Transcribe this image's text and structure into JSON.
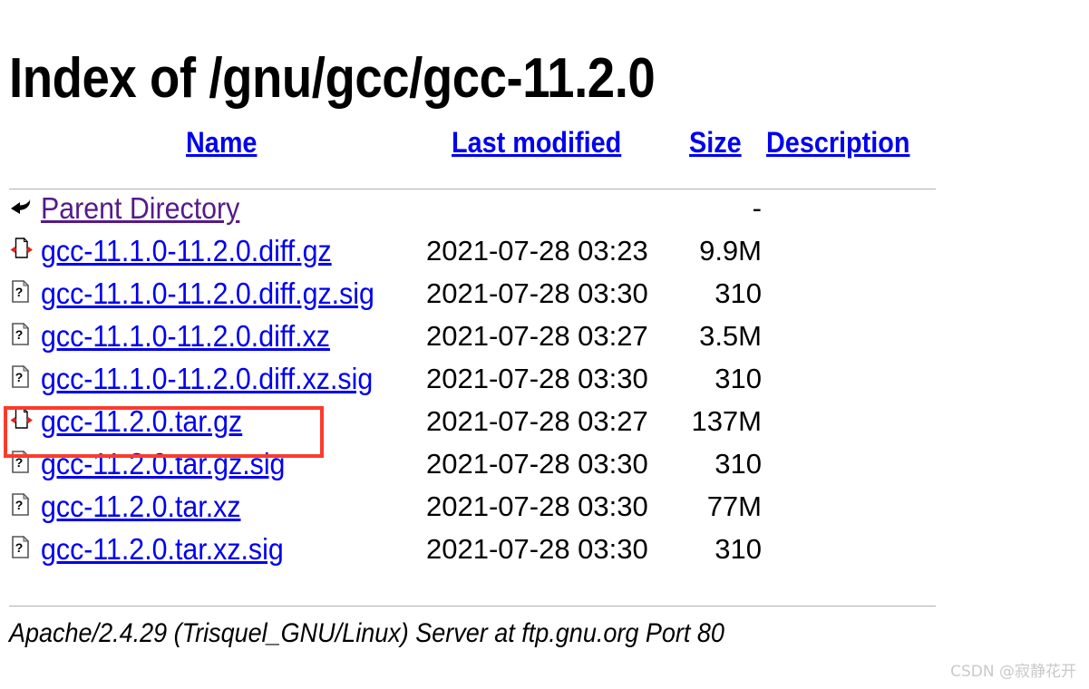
{
  "page": {
    "title": "Index of /gnu/gcc/gcc-11.2.0"
  },
  "colors": {
    "link": "#0000EE",
    "visited_link": "#551A8B",
    "text": "#000000",
    "rule": "#B0B0B0",
    "highlight_box": "#FC3B2D",
    "watermark": "#C9C9C9",
    "background": "#FFFFFF"
  },
  "table": {
    "headers": [
      {
        "label": "Name",
        "icon": "sort-name-link"
      },
      {
        "label": "Last modified",
        "icon": "sort-modified-link"
      },
      {
        "label": "Size",
        "icon": "sort-size-link"
      },
      {
        "label": "Description",
        "icon": "sort-description-link"
      }
    ],
    "rows": [
      {
        "icon": "parent-directory-icon",
        "name": "Parent Directory",
        "date": "",
        "size": "-",
        "description": "",
        "visited": true,
        "highlighted": false
      },
      {
        "icon": "compressed-file-icon",
        "name": "gcc-11.1.0-11.2.0.diff.gz",
        "date": "2021-07-28 03:23",
        "size": "9.9M",
        "description": "",
        "visited": false,
        "highlighted": false
      },
      {
        "icon": "unknown-file-icon",
        "name": "gcc-11.1.0-11.2.0.diff.gz.sig",
        "date": "2021-07-28 03:30",
        "size": "310",
        "description": "",
        "visited": false,
        "highlighted": false
      },
      {
        "icon": "unknown-file-icon",
        "name": "gcc-11.1.0-11.2.0.diff.xz",
        "date": "2021-07-28 03:27",
        "size": "3.5M",
        "description": "",
        "visited": false,
        "highlighted": false
      },
      {
        "icon": "unknown-file-icon",
        "name": "gcc-11.1.0-11.2.0.diff.xz.sig",
        "date": "2021-07-28 03:30",
        "size": "310",
        "description": "",
        "visited": false,
        "highlighted": false
      },
      {
        "icon": "compressed-file-icon",
        "name": "gcc-11.2.0.tar.gz",
        "date": "2021-07-28 03:27",
        "size": "137M",
        "description": "",
        "visited": false,
        "highlighted": true
      },
      {
        "icon": "unknown-file-icon",
        "name": "gcc-11.2.0.tar.gz.sig",
        "date": "2021-07-28 03:30",
        "size": "310",
        "description": "",
        "visited": false,
        "highlighted": false
      },
      {
        "icon": "unknown-file-icon",
        "name": "gcc-11.2.0.tar.xz",
        "date": "2021-07-28 03:30",
        "size": "77M",
        "description": "",
        "visited": false,
        "highlighted": false
      },
      {
        "icon": "unknown-file-icon",
        "name": "gcc-11.2.0.tar.xz.sig",
        "date": "2021-07-28 03:30",
        "size": "310",
        "description": "",
        "visited": false,
        "highlighted": false
      }
    ]
  },
  "footer": {
    "server_signature": "Apache/2.4.29 (Trisquel_GNU/Linux) Server at ftp.gnu.org Port 80"
  },
  "watermark": {
    "text": "CSDN @寂静花开"
  }
}
